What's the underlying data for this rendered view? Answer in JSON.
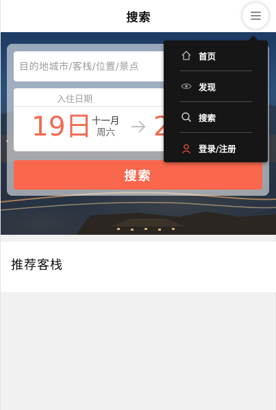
{
  "header": {
    "title": "搜索",
    "menu_icon": "hamburger-icon"
  },
  "search_form": {
    "destination_placeholder": "目的地城市/客栈/位置/景点",
    "checkin": {
      "label": "入住日期",
      "day": "19日",
      "month": "十一月",
      "weekday": "周六"
    },
    "checkout": {
      "day": "20日"
    },
    "search_button": "搜索",
    "accent_color": "#f9674d"
  },
  "recommend": {
    "title": "推荐客栈"
  },
  "dropdown_menu": {
    "items": [
      {
        "label": "首页",
        "icon": "home-icon"
      },
      {
        "label": "发现",
        "icon": "eye-icon"
      },
      {
        "label": "搜索",
        "icon": "search-icon"
      },
      {
        "label": "登录/注册",
        "icon": "user-icon"
      }
    ],
    "user_icon_color": "#e0493a"
  }
}
